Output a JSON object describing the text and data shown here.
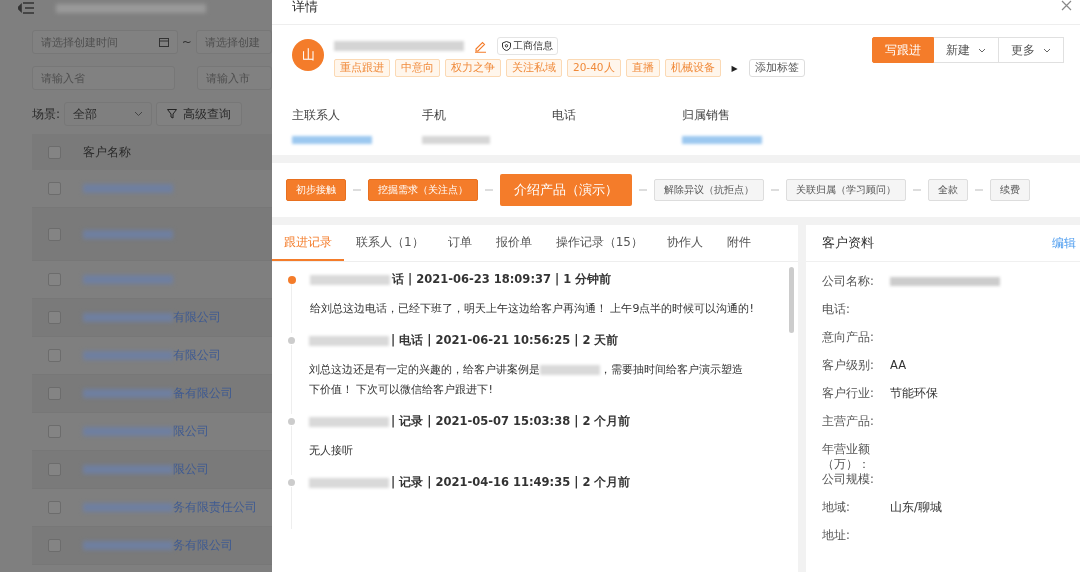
{
  "background_page": {
    "filters": {
      "date_start": {
        "placeholder": "请选择创建时间"
      },
      "date_sep": "~",
      "date_end": {
        "placeholder": "请选择创建"
      },
      "province": {
        "placeholder": "请输入省"
      },
      "city": {
        "placeholder": "请输入市"
      }
    },
    "scene_label": "场景:",
    "scene_select": "全部",
    "advanced_button": "高级查询",
    "table": {
      "columns": [
        "客户名称"
      ],
      "all_checked": false,
      "rows": [
        {
          "name_tail": "",
          "checked": false
        },
        {
          "name_tail": "",
          "checked": false
        },
        {
          "name_tail": "",
          "checked": false
        },
        {
          "name_tail": "有限公司",
          "checked": false
        },
        {
          "name_tail": "有限公司",
          "checked": false
        },
        {
          "name_tail": "备有限公司",
          "checked": false
        },
        {
          "name_tail": "限公司",
          "checked": false
        },
        {
          "name_tail": "限公司",
          "checked": false
        },
        {
          "name_tail": "务有限责任公司",
          "checked": false
        },
        {
          "name_tail": "务有限公司",
          "checked": false
        }
      ]
    }
  },
  "drawer": {
    "title": "详情",
    "customer": {
      "avatar": "山",
      "business_info": "工商信息",
      "tags": [
        "重点跟进",
        "中意向",
        "权力之争",
        "关注私域",
        "20-40人",
        "直播",
        "机械设备"
      ],
      "more_tags": "▶",
      "add_tag": "添加标签"
    },
    "actions": {
      "primary": "写跟进",
      "new": "新建",
      "more": "更多"
    },
    "contacts": [
      {
        "label": "主联系人",
        "kind": "link"
      },
      {
        "label": "手机",
        "kind": "text"
      },
      {
        "label": "电话",
        "kind": "empty"
      },
      {
        "label": "归属销售",
        "kind": "link"
      }
    ],
    "stages": [
      {
        "label": "初步接触",
        "completed": true,
        "selected": false
      },
      {
        "label": "挖掘需求（关注点）",
        "completed": true,
        "selected": false
      },
      {
        "label": "介绍产品（演示）",
        "completed": false,
        "selected": true
      },
      {
        "label": "解除异议（抗拒点）",
        "completed": false,
        "selected": false
      },
      {
        "label": "关联归属（学习顾问）",
        "completed": false,
        "selected": false
      },
      {
        "label": "全款",
        "completed": false,
        "selected": false
      },
      {
        "label": "续费",
        "completed": false,
        "selected": false
      }
    ],
    "tabs": [
      {
        "label": "跟进记录",
        "selected": true
      },
      {
        "label": "联系人（1）",
        "selected": false
      },
      {
        "label": "订单",
        "selected": false
      },
      {
        "label": "报价单",
        "selected": false
      },
      {
        "label": "操作记录（15）",
        "selected": false
      },
      {
        "label": "协作人",
        "selected": false
      },
      {
        "label": "附件",
        "selected": false
      }
    ],
    "timeline": [
      {
        "active": true,
        "header": "话 | 2021-06-23 18:09:37 | 1 分钟前",
        "body": [
          [
            "给刘总这边电话，已经下班了，明天上午这边给客户再沟通！ 上午9点半的时候可以沟通的!"
          ]
        ]
      },
      {
        "active": false,
        "header": "| 电话 | 2021-06-21 10:56:25 | 2 天前",
        "body": [
          [
            "刘总这边还是有一定的兴趣的，给客户讲案例是",
            "，需要抽时间给客户演示塑造"
          ],
          [
            "下价值！ 下次可以微信给客户跟进下!"
          ]
        ]
      },
      {
        "active": false,
        "header": "| 记录 | 2021-05-07 15:03:38 | 2 个月前",
        "body": [
          [
            "无人接听"
          ]
        ]
      },
      {
        "active": false,
        "header": "| 记录 | 2021-04-16 11:49:35 | 2 个月前"
      }
    ],
    "profile": {
      "title": "客户资料",
      "edit": "编辑",
      "fields": [
        {
          "label": "公司名称:",
          "redacted": true
        },
        {
          "label": "电话:",
          "redacted": false
        },
        {
          "label": "意向产品:",
          "redacted": false
        },
        {
          "label": "客户级别:",
          "value": "AA",
          "redacted": false
        },
        {
          "label": "客户行业:",
          "value": "节能环保",
          "redacted": false
        },
        {
          "label": "主营产品:",
          "redacted": false
        },
        {
          "label": "年营业额（万）：",
          "redacted": false
        },
        {
          "label": "公司规模:",
          "redacted": false
        },
        {
          "label": "地域:",
          "value": "山东/聊城",
          "redacted": false
        },
        {
          "label": "地址:",
          "redacted": false
        }
      ]
    }
  }
}
